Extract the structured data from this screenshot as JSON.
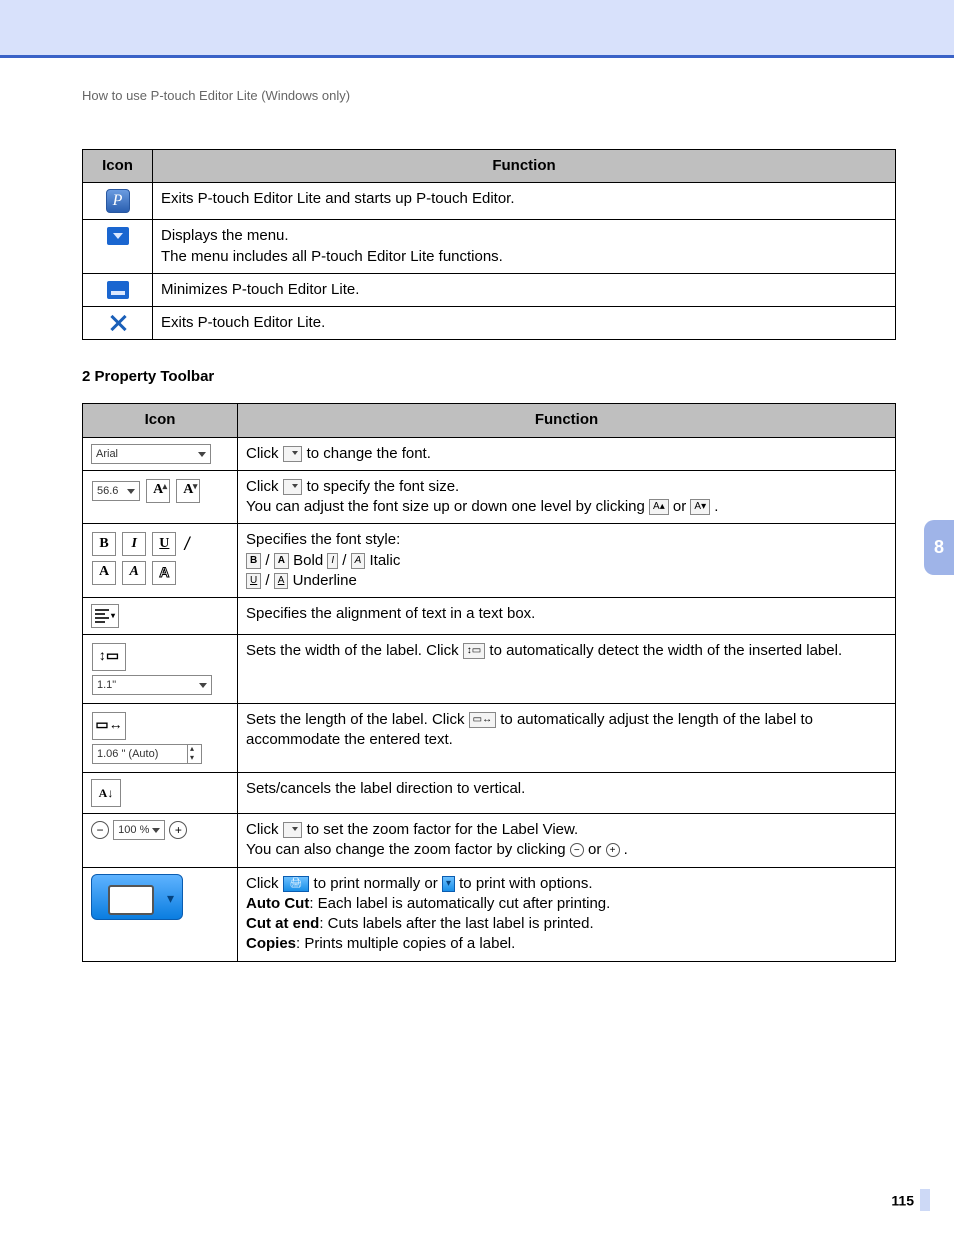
{
  "breadcrumb": "How to use P-touch Editor Lite (Windows only)",
  "side_tab": "8",
  "page_number": "115",
  "table1": {
    "headers": {
      "icon": "Icon",
      "function": "Function"
    },
    "rows": [
      {
        "fn": "Exits P-touch Editor Lite and starts up P-touch Editor."
      },
      {
        "fn_line1": "Displays the menu.",
        "fn_line2": "The menu includes all P-touch Editor Lite functions."
      },
      {
        "fn": "Minimizes P-touch Editor Lite."
      },
      {
        "fn": "Exits P-touch Editor Lite."
      }
    ]
  },
  "section2_title": "2  Property Toolbar",
  "table2": {
    "headers": {
      "icon": "Icon",
      "function": "Function"
    },
    "font_name": "Arial",
    "font_size": "56.6",
    "width_value": "1.1\"",
    "length_value": "1.06 \" (Auto)",
    "zoom_value": "100 %",
    "row_font": {
      "pre": "Click ",
      "post": " to change the font."
    },
    "row_size": {
      "l1_pre": "Click ",
      "l1_post": " to specify the font size.",
      "l2_pre": "You can adjust the font size up or down one level by clicking ",
      "l2_mid": " or ",
      "l2_post": "."
    },
    "row_style": {
      "title": "Specifies the font style:",
      "bold": " Bold ",
      "italic": " Italic",
      "underline": " Underline"
    },
    "row_align": "Specifies the alignment of text in a text box.",
    "row_width": {
      "pre": "Sets the width of the label. Click ",
      "post": " to automatically detect the width of the inserted label."
    },
    "row_length": {
      "pre": "Sets the length of the label. Click ",
      "post": " to automatically adjust the length of the label to accommodate the entered text."
    },
    "row_vertical": "Sets/cancels the label direction to vertical.",
    "row_zoom": {
      "l1_pre": "Click ",
      "l1_post": " to set the zoom factor for the Label View.",
      "l2_pre": "You can also change the zoom factor by clicking ",
      "l2_mid": " or ",
      "l2_post": "."
    },
    "row_print": {
      "l1_pre": "Click ",
      "l1_mid": " to print normally or ",
      "l1_post": " to print with options.",
      "auto_cut_label": "Auto Cut",
      "auto_cut_text": ": Each label is automatically cut after printing.",
      "cut_end_label": "Cut at end",
      "cut_end_text": ": Cuts labels after the last label is printed.",
      "copies_label": "Copies",
      "copies_text": ": Prints multiple copies of a label."
    }
  }
}
